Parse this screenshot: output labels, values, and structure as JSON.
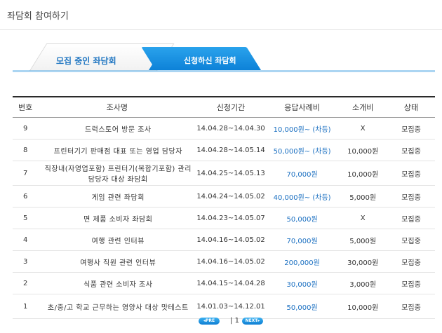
{
  "header": {
    "title": "좌담회 참여하기"
  },
  "tabs": [
    {
      "label": "모집 중인 좌담회"
    },
    {
      "label": "신청하신 좌담회"
    }
  ],
  "table": {
    "columns": [
      "번호",
      "조사명",
      "신청기간",
      "응답사례비",
      "소개비",
      "상태"
    ],
    "rows": [
      {
        "no": "9",
        "title": "드럭스토어 방문 조사",
        "period": "14.04.28~14.04.30",
        "reward": "10,000원~ (차등)",
        "fee": "X",
        "status": "모집중"
      },
      {
        "no": "8",
        "title": "프린터기기 판매점 대표 또는 영업 담당자",
        "period": "14.04.28~14.05.14",
        "reward": "50,000원~ (차등)",
        "fee": "10,000원",
        "status": "모집중"
      },
      {
        "no": "7",
        "title": "직장내(자영업포함) 프린터기(복합기포함) 관리 담당자 대상 좌담회",
        "period": "14.04.25~14.05.13",
        "reward": "70,000원",
        "fee": "10,000원",
        "status": "모집중"
      },
      {
        "no": "6",
        "title": "게임 관련 좌담회",
        "period": "14.04.24~14.05.02",
        "reward": "40,000원~ (차등)",
        "fee": "5,000원",
        "status": "모집중"
      },
      {
        "no": "5",
        "title": "면 제품 소비자 좌담회",
        "period": "14.04.23~14.05.07",
        "reward": "50,000원",
        "fee": "X",
        "status": "모집중"
      },
      {
        "no": "4",
        "title": "여행 관련 인터뷰",
        "period": "14.04.16~14.05.02",
        "reward": "70,000원",
        "fee": "5,000원",
        "status": "모집중"
      },
      {
        "no": "3",
        "title": "여행사 직원 관련 인터뷰",
        "period": "14.04.16~14.05.02",
        "reward": "200,000원",
        "fee": "30,000원",
        "status": "모집중"
      },
      {
        "no": "2",
        "title": "식품 관련 소비자 조사",
        "period": "14.04.15~14.04.28",
        "reward": "30,000원",
        "fee": "3,000원",
        "status": "모집중"
      },
      {
        "no": "1",
        "title": "초/중/고 학교 근무하는 영양사 대상 맛테스트",
        "period": "14.01.03~14.12.01",
        "reward": "50,000원",
        "fee": "10,000원",
        "status": "모집중"
      }
    ]
  },
  "pagination": {
    "prev": "PRE",
    "page": "1",
    "next": "NEXT"
  },
  "colors": {
    "accent": "#0f86d9",
    "reward_text": "#1a6fc1"
  }
}
